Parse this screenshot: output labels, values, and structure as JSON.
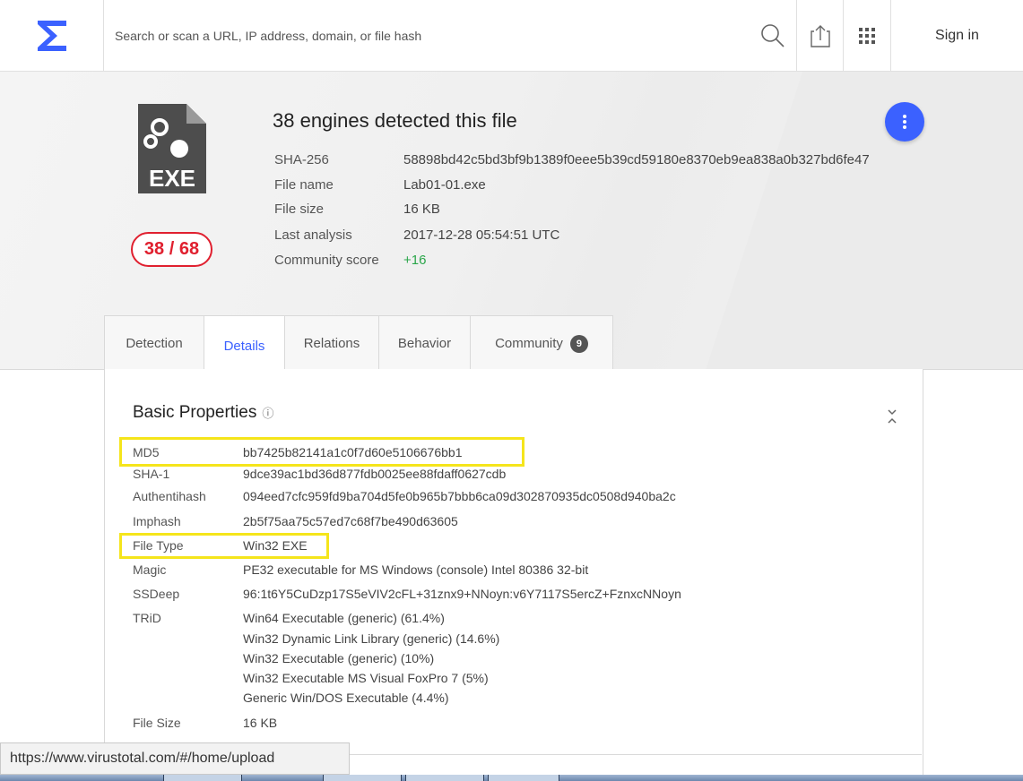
{
  "topbar": {
    "search_placeholder": "Search or scan a URL, IP address, domain, or file hash",
    "sign_in": "Sign in",
    "logo_icon": "virustotal-sigma-icon",
    "search_icon": "search-icon",
    "upload_icon": "upload-icon",
    "apps_icon": "apps-grid-icon"
  },
  "summary": {
    "title": "38 engines detected this file",
    "score": "38 / 68",
    "file_icon": "exe-file-icon",
    "meta": [
      {
        "label": "SHA-256",
        "value": "58898bd42c5bd3bf9b1389f0eee5b39cd59180e8370eb9ea838a0b327bd6fe47"
      },
      {
        "label": "File name",
        "value": "Lab01-01.exe"
      },
      {
        "label": "File size",
        "value": "16 KB"
      },
      {
        "label": "Last analysis",
        "value": "2017-12-28 05:54:51 UTC"
      },
      {
        "label": "Community score",
        "value": "+16"
      }
    ]
  },
  "tabs": [
    {
      "label": "Detection"
    },
    {
      "label": "Details",
      "active": true
    },
    {
      "label": "Relations"
    },
    {
      "label": "Behavior"
    },
    {
      "label": "Community",
      "badge": "9"
    }
  ],
  "basic_properties": {
    "title": "Basic Properties",
    "info_icon": "ⓘ",
    "rows": [
      {
        "label": "MD5",
        "value": "bb7425b82141a1c0f7d60e5106676bb1"
      },
      {
        "label": "SHA-1",
        "value": "9dce39ac1bd36d877fdb0025ee88fdaff0627cdb"
      },
      {
        "label": "Authentihash",
        "value": "094eed7cfc959fd9ba704d5fe0b965b7bbb6ca09d302870935dc0508d940ba2c"
      },
      {
        "label": "Imphash",
        "value": "2b5f75aa75c57ed7c68f7be490d63605"
      },
      {
        "label": "File Type",
        "value": "Win32 EXE"
      },
      {
        "label": "Magic",
        "value": "PE32 executable for MS Windows (console) Intel 80386 32-bit"
      },
      {
        "label": "SSDeep",
        "value": "96:1t6Y5CuDzp17S5eVIV2cFL+31znx9+NNoyn:v6Y7117S5ercZ+FznxcNNoyn"
      },
      {
        "label": "TRiD",
        "value": "Win64 Executable (generic) (61.4%)"
      },
      {
        "label": "",
        "value": "Win32 Dynamic Link Library (generic) (14.6%)"
      },
      {
        "label": "",
        "value": "Win32 Executable (generic) (10%)"
      },
      {
        "label": "",
        "value": "Win32 Executable MS Visual FoxPro 7 (5%)"
      },
      {
        "label": "",
        "value": "Generic Win/DOS Executable (4.4%)"
      },
      {
        "label": "File Size",
        "value": "16 KB"
      }
    ]
  },
  "status_bar": {
    "url": "https://www.virustotal.com/#/home/upload"
  },
  "colors": {
    "accent": "#3b61ff",
    "detection_red": "#e0202f",
    "highlight_yellow": "#f5e51b",
    "positive_green": "#2aa64a"
  }
}
